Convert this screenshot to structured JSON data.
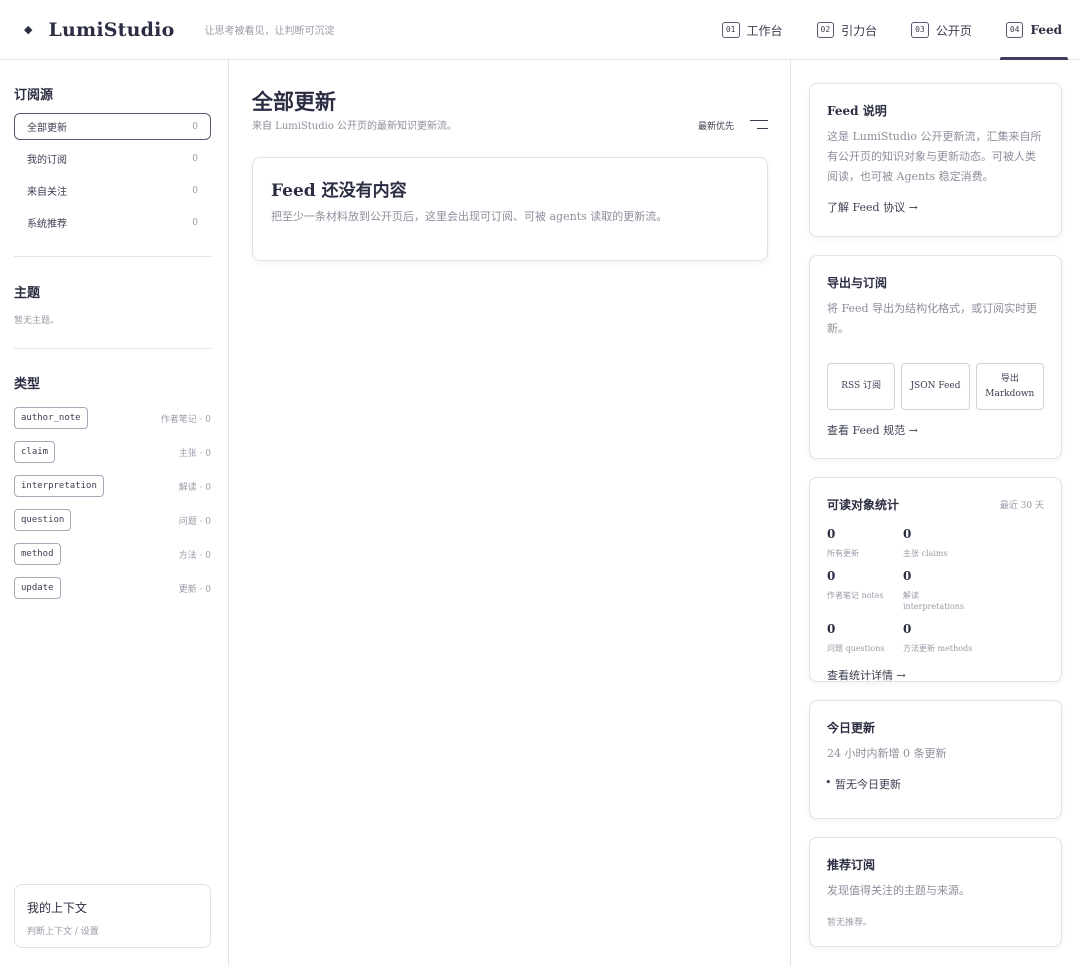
{
  "header": {
    "brand_mark": "◆",
    "brand_name": "LumiStudio",
    "tagline": "让思考被看见，让判断可沉淀",
    "nav": [
      {
        "num": "01",
        "label": "工作台"
      },
      {
        "num": "02",
        "label": "引力台"
      },
      {
        "num": "03",
        "label": "公开页"
      },
      {
        "num": "04",
        "label": "Feed"
      }
    ]
  },
  "sidebar": {
    "sources_heading": "订阅源",
    "sources": [
      {
        "label": "全部更新",
        "count": "0"
      },
      {
        "label": "我的订阅",
        "count": "0"
      },
      {
        "label": "来自关注",
        "count": "0"
      },
      {
        "label": "系统推荐",
        "count": "0"
      }
    ],
    "topics_heading": "主题",
    "topics_empty": "暂无主题。",
    "types_heading": "类型",
    "types": [
      {
        "chip": "author_note",
        "meta": "作者笔记 · 0"
      },
      {
        "chip": "claim",
        "meta": "主张 · 0"
      },
      {
        "chip": "interpretation",
        "meta": "解读 · 0"
      },
      {
        "chip": "question",
        "meta": "问题 · 0"
      },
      {
        "chip": "method",
        "meta": "方法 · 0"
      },
      {
        "chip": "update",
        "meta": "更新 · 0"
      }
    ],
    "context": {
      "title": "我的上下文",
      "sub": "判断上下文 / 设置"
    }
  },
  "main": {
    "title": "全部更新",
    "subtitle": "来自 LumiStudio 公开页的最新知识更新流。",
    "sort_label": "最新优先",
    "empty": {
      "title": "Feed 还没有内容",
      "text": "把至少一条材料放到公开页后，这里会出现可订阅、可被 agents 读取的更新流。"
    }
  },
  "right": {
    "about": {
      "title": "Feed 说明",
      "text": "这是 LumiStudio 公开更新流，汇集来自所有公开页的知识对象与更新动态。可被人类阅读，也可被 Agents 稳定消费。",
      "link": "了解 Feed 协议 →"
    },
    "export": {
      "title": "导出与订阅",
      "text": "将 Feed 导出为结构化格式，或订阅实时更新。",
      "buttons": [
        "RSS 订阅",
        "JSON Feed",
        "导出 Markdown"
      ],
      "link": "查看 Feed 规范 →"
    },
    "stats": {
      "title": "可读对象统计",
      "range": "最近 30 天",
      "items": [
        {
          "value": "0",
          "label": "所有更新"
        },
        {
          "value": "0",
          "label": "主张 claims"
        },
        {
          "value": "0",
          "label": "作者笔记 notes"
        },
        {
          "value": "0",
          "label": "解读 interpretations"
        },
        {
          "value": "0",
          "label": "问题 questions"
        },
        {
          "value": "0",
          "label": "方法更新 methods"
        }
      ],
      "link": "查看统计详情 →"
    },
    "today": {
      "title": "今日更新",
      "text": "24 小时内新增 0 条更新",
      "item": "暂无今日更新"
    },
    "recommend": {
      "title": "推荐订阅",
      "text": "发现值得关注的主题与来源。",
      "empty": "暂无推荐。"
    }
  }
}
